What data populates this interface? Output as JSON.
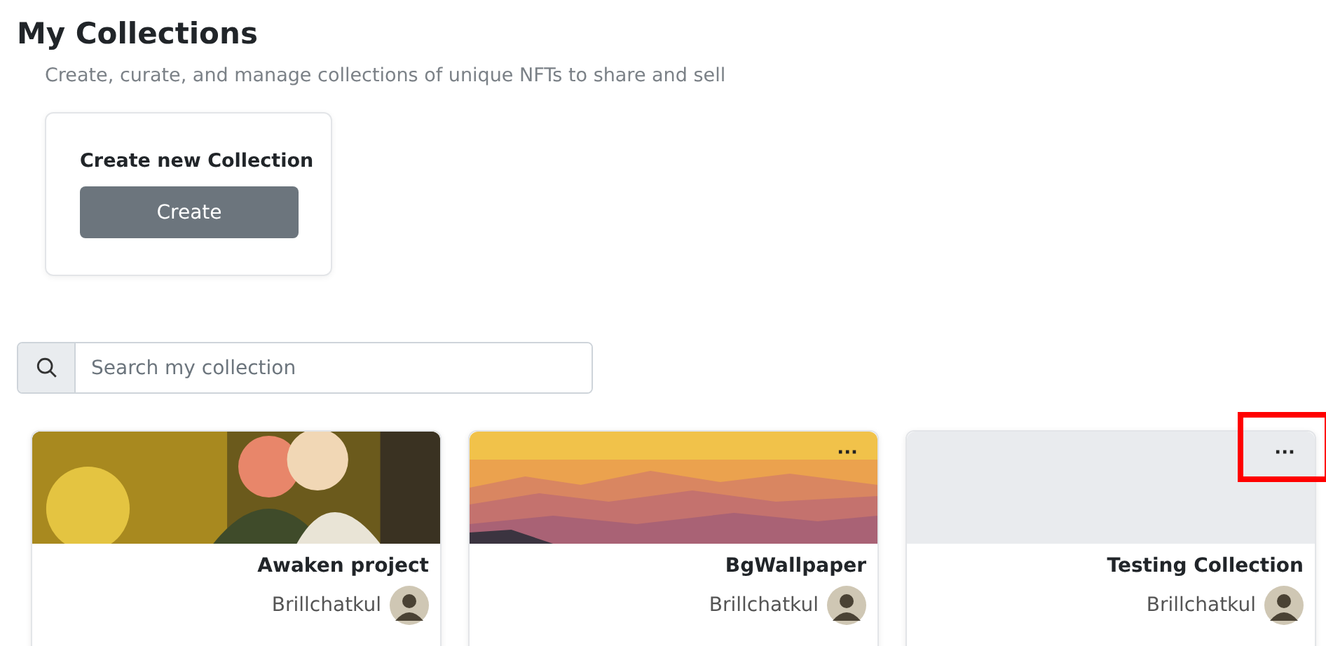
{
  "header": {
    "title": "My Collections",
    "subtitle": "Create, curate, and manage collections of unique NFTs to share and sell"
  },
  "create_card": {
    "heading": "Create new Collection",
    "button": "Create"
  },
  "search": {
    "placeholder": "Search my collection"
  },
  "collections": [
    {
      "name": "Awaken project",
      "author": "Brillchatkul",
      "kind": "picture",
      "highlighted": false
    },
    {
      "name": "BgWallpaper",
      "author": "Brillchatkul",
      "kind": "picture",
      "menu": "···",
      "highlighted": false
    },
    {
      "name": "Testing Collection",
      "author": "Brillchatkul",
      "kind": "blank",
      "menu": "···",
      "highlighted": true
    }
  ]
}
